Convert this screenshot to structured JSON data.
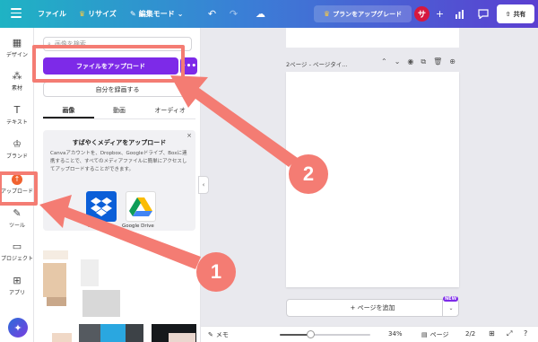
{
  "topbar": {
    "file_label": "ファイル",
    "resize_label": "リサイズ",
    "edit_mode_label": "編集モード",
    "upgrade_label": "プランをアップグレード",
    "avatar_initial": "サ",
    "share_label": "共有"
  },
  "rail": {
    "items": [
      {
        "label": "デザイン",
        "icon": "design-icon"
      },
      {
        "label": "素材",
        "icon": "elements-icon"
      },
      {
        "label": "テキスト",
        "icon": "text-icon"
      },
      {
        "label": "ブランド",
        "icon": "brand-icon"
      },
      {
        "label": "アップロード",
        "icon": "upload-cloud-icon"
      },
      {
        "label": "ツール",
        "icon": "draw-icon"
      },
      {
        "label": "プロジェクト",
        "icon": "folder-icon"
      },
      {
        "label": "アプリ",
        "icon": "apps-icon"
      }
    ]
  },
  "panel": {
    "search_placeholder": "画像を検索",
    "upload_button_label": "ファイルをアップロード",
    "more_label": "•••",
    "record_button_label": "自分を録画する",
    "tabs": [
      {
        "label": "画像"
      },
      {
        "label": "動画"
      },
      {
        "label": "オーディオ"
      }
    ],
    "promo": {
      "title": "すばやくメディアをアップロード",
      "close": "×",
      "description": "Canvaアカウントを、Dropbox、Googleドライブ、Boxに連携することで、すべてのメディアファイルに簡単にアクセスしてアップロードすることができます。",
      "services": [
        {
          "label": "Dropbox",
          "color": "#0b5fd8"
        },
        {
          "label": "Google Drive",
          "color": "#ffffff"
        }
      ]
    }
  },
  "canvas": {
    "page_title": "2ページ - ページタイ...",
    "add_page_label": "+ ページを追加",
    "new_badge": "NEW"
  },
  "bottombar": {
    "notes_label": "メモ",
    "zoom": "34%",
    "pages_label": "ページ",
    "page_count": "2/2",
    "zoom_fraction": 0.34
  },
  "annotations": {
    "callout_1": "1",
    "callout_2": "2",
    "color": "#f47c73"
  }
}
